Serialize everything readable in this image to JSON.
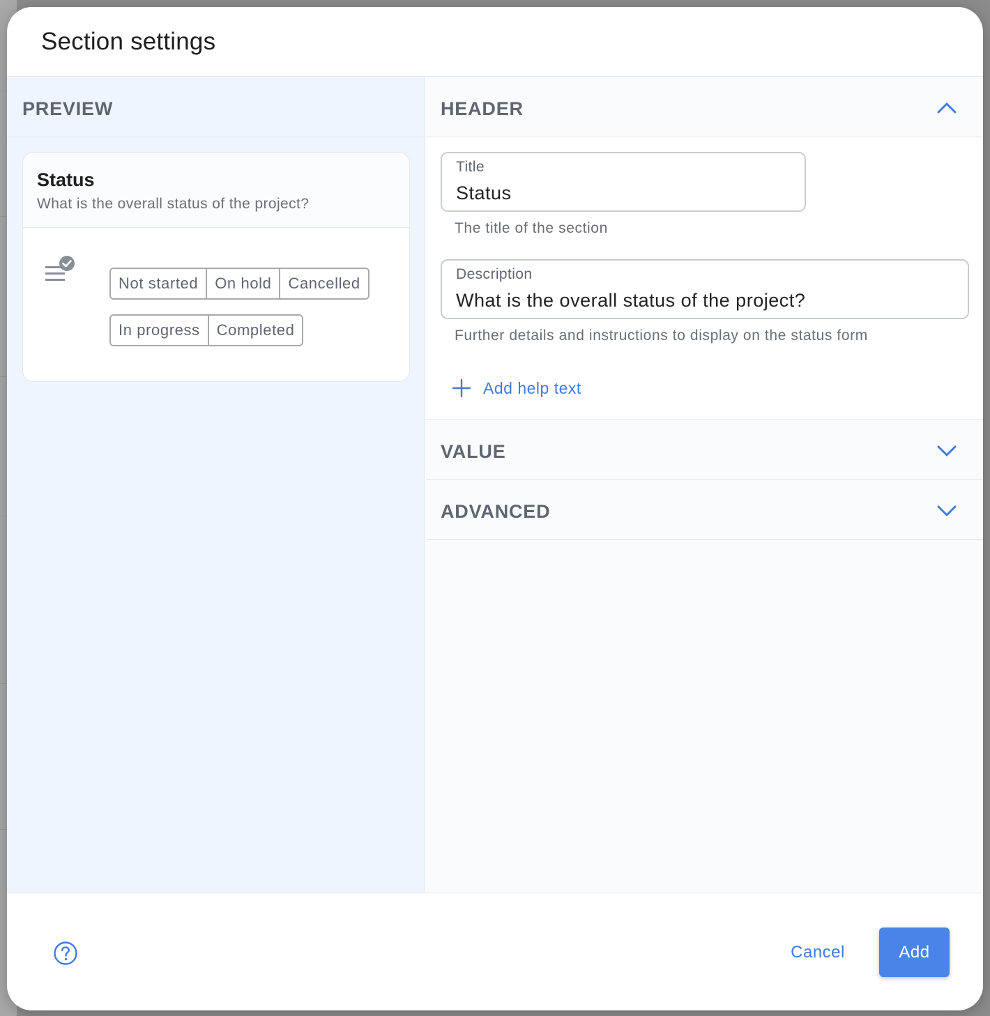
{
  "dialog": {
    "title": "Section settings"
  },
  "preview": {
    "heading": "PREVIEW",
    "card": {
      "title": "Status",
      "description": "What is the overall status of the project?",
      "icon": "status-list-check-icon",
      "options_row1": [
        "Not started",
        "On hold",
        "Cancelled"
      ],
      "options_row2": [
        "In progress",
        "Completed"
      ]
    }
  },
  "settings": {
    "header": {
      "label": "HEADER",
      "expanded": true,
      "title_field": {
        "label": "Title",
        "value": "Status",
        "helper": "The title of the section"
      },
      "description_field": {
        "label": "Description",
        "value": "What is the overall status of the project?",
        "helper": "Further details and instructions to display on the status form"
      },
      "add_help_text": "Add help text"
    },
    "value": {
      "label": "VALUE",
      "expanded": false
    },
    "advanced": {
      "label": "ADVANCED",
      "expanded": false
    }
  },
  "footer": {
    "cancel_label": "Cancel",
    "add_label": "Add",
    "help_icon": "help-circle-icon"
  },
  "colors": {
    "accent": "#4a84e8",
    "link": "#3f7be0",
    "preview_bg": "#eef5fe",
    "section_heading": "#5f6670"
  }
}
